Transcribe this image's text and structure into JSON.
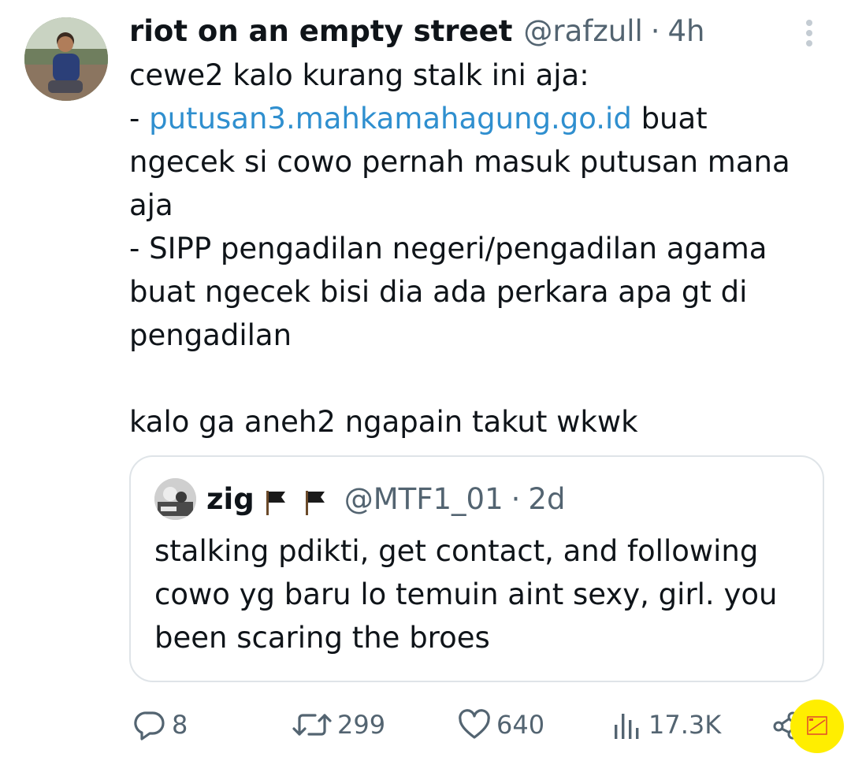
{
  "tweet": {
    "display_name": "riot on an empty street",
    "handle": "@rafzull",
    "separator": "·",
    "time": "4h",
    "more_icon": "more-vertical-icon",
    "text_lines": [
      "cewe2 kalo kurang stalk ini aja:",
      "- ",
      "putusan3.mahkamahagung.go.id",
      " buat",
      "ngecek si cowo pernah masuk putusan mana",
      "aja",
      "- SIPP pengadilan negeri/pengadilan agama",
      "buat ngecek bisi dia ada perkara apa gt di",
      "pengadilan",
      "kalo ga aneh2 ngapain takut wkwk"
    ]
  },
  "quote": {
    "display_name": "zig",
    "flags": [
      "black-flag-icon",
      "black-flag-icon"
    ],
    "handle": "@MTF1_01",
    "separator": "·",
    "time": "2d",
    "text_lines": [
      "stalking pdikti, get contact, and following",
      "cowo yg baru lo temuin aint sexy, girl. you",
      "been scaring the broes"
    ]
  },
  "actions": {
    "reply_count": "8",
    "retweet_count": "299",
    "like_count": "640",
    "views_count": "17.3K"
  },
  "colors": {
    "link": "#2f8fcf",
    "secondary_text": "#536471",
    "primary_text": "#0f1419",
    "border": "#dfe4e8",
    "badge": "#ffee00"
  }
}
